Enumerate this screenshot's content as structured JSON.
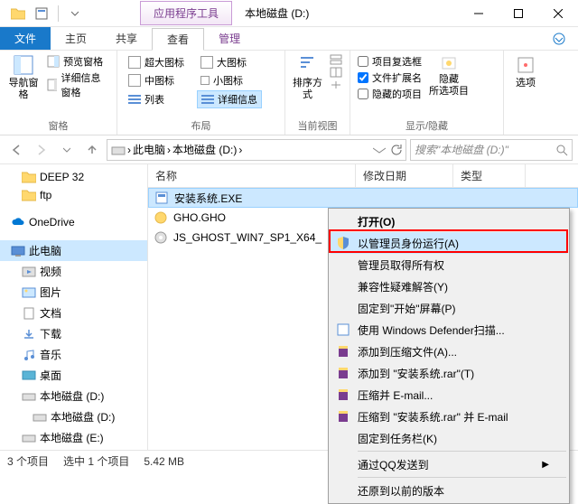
{
  "title": "本地磁盘 (D:)",
  "context_tab": "应用程序工具",
  "tabs": {
    "file": "文件",
    "home": "主页",
    "share": "共享",
    "view": "查看",
    "manage": "管理"
  },
  "ribbon": {
    "pane": {
      "nav": "导航窗格",
      "preview": "预览窗格",
      "details": "详细信息窗格",
      "label": "窗格"
    },
    "layout": {
      "xlarge": "超大图标",
      "large": "大图标",
      "medium": "中图标",
      "small": "小图标",
      "list": "列表",
      "details": "详细信息",
      "label": "布局"
    },
    "current": {
      "sort": "排序方式",
      "label": "当前视图"
    },
    "showhide": {
      "checkboxes": "项目复选框",
      "ext": "文件扩展名",
      "hidden": "隐藏的项目",
      "hidesel": "隐藏\n所选项目",
      "label": "显示/隐藏"
    },
    "options": "选项"
  },
  "breadcrumb": {
    "pc": "此电脑",
    "drive": "本地磁盘 (D:)"
  },
  "search_placeholder": "搜索\"本地磁盘 (D:)\"",
  "tree": {
    "deep32": "DEEP 32",
    "ftp": "ftp",
    "onedrive": "OneDrive",
    "thispc": "此电脑",
    "videos": "视频",
    "pictures": "图片",
    "documents": "文档",
    "downloads": "下载",
    "music": "音乐",
    "desktop": "桌面",
    "driveD": "本地磁盘 (D:)",
    "driveD2": "本地磁盘 (D:)",
    "driveE": "本地磁盘 (E:)"
  },
  "columns": {
    "name": "名称",
    "date": "修改日期",
    "type": "类型"
  },
  "files": {
    "f1": "安装系统.EXE",
    "f2": "GHO.GHO",
    "f3": "JS_GHOST_WIN7_SP1_X64_"
  },
  "menu": {
    "open": "打开(O)",
    "runas": "以管理员身份运行(A)",
    "takeown": "管理员取得所有权",
    "compat": "兼容性疑难解答(Y)",
    "pin_start": "固定到\"开始\"屏幕(P)",
    "defender": "使用 Windows Defender扫描...",
    "archive_add": "添加到压缩文件(A)...",
    "archive_to": "添加到 \"安装系统.rar\"(T)",
    "email": "压缩并 E-mail...",
    "email_to": "压缩到 \"安装系统.rar\" 并 E-mail",
    "pin_task": "固定到任务栏(K)",
    "qq": "通过QQ发送到",
    "restore": "还原到以前的版本"
  },
  "status": {
    "count": "3 个项目",
    "selected": "选中 1 个项目",
    "size": "5.42 MB"
  }
}
